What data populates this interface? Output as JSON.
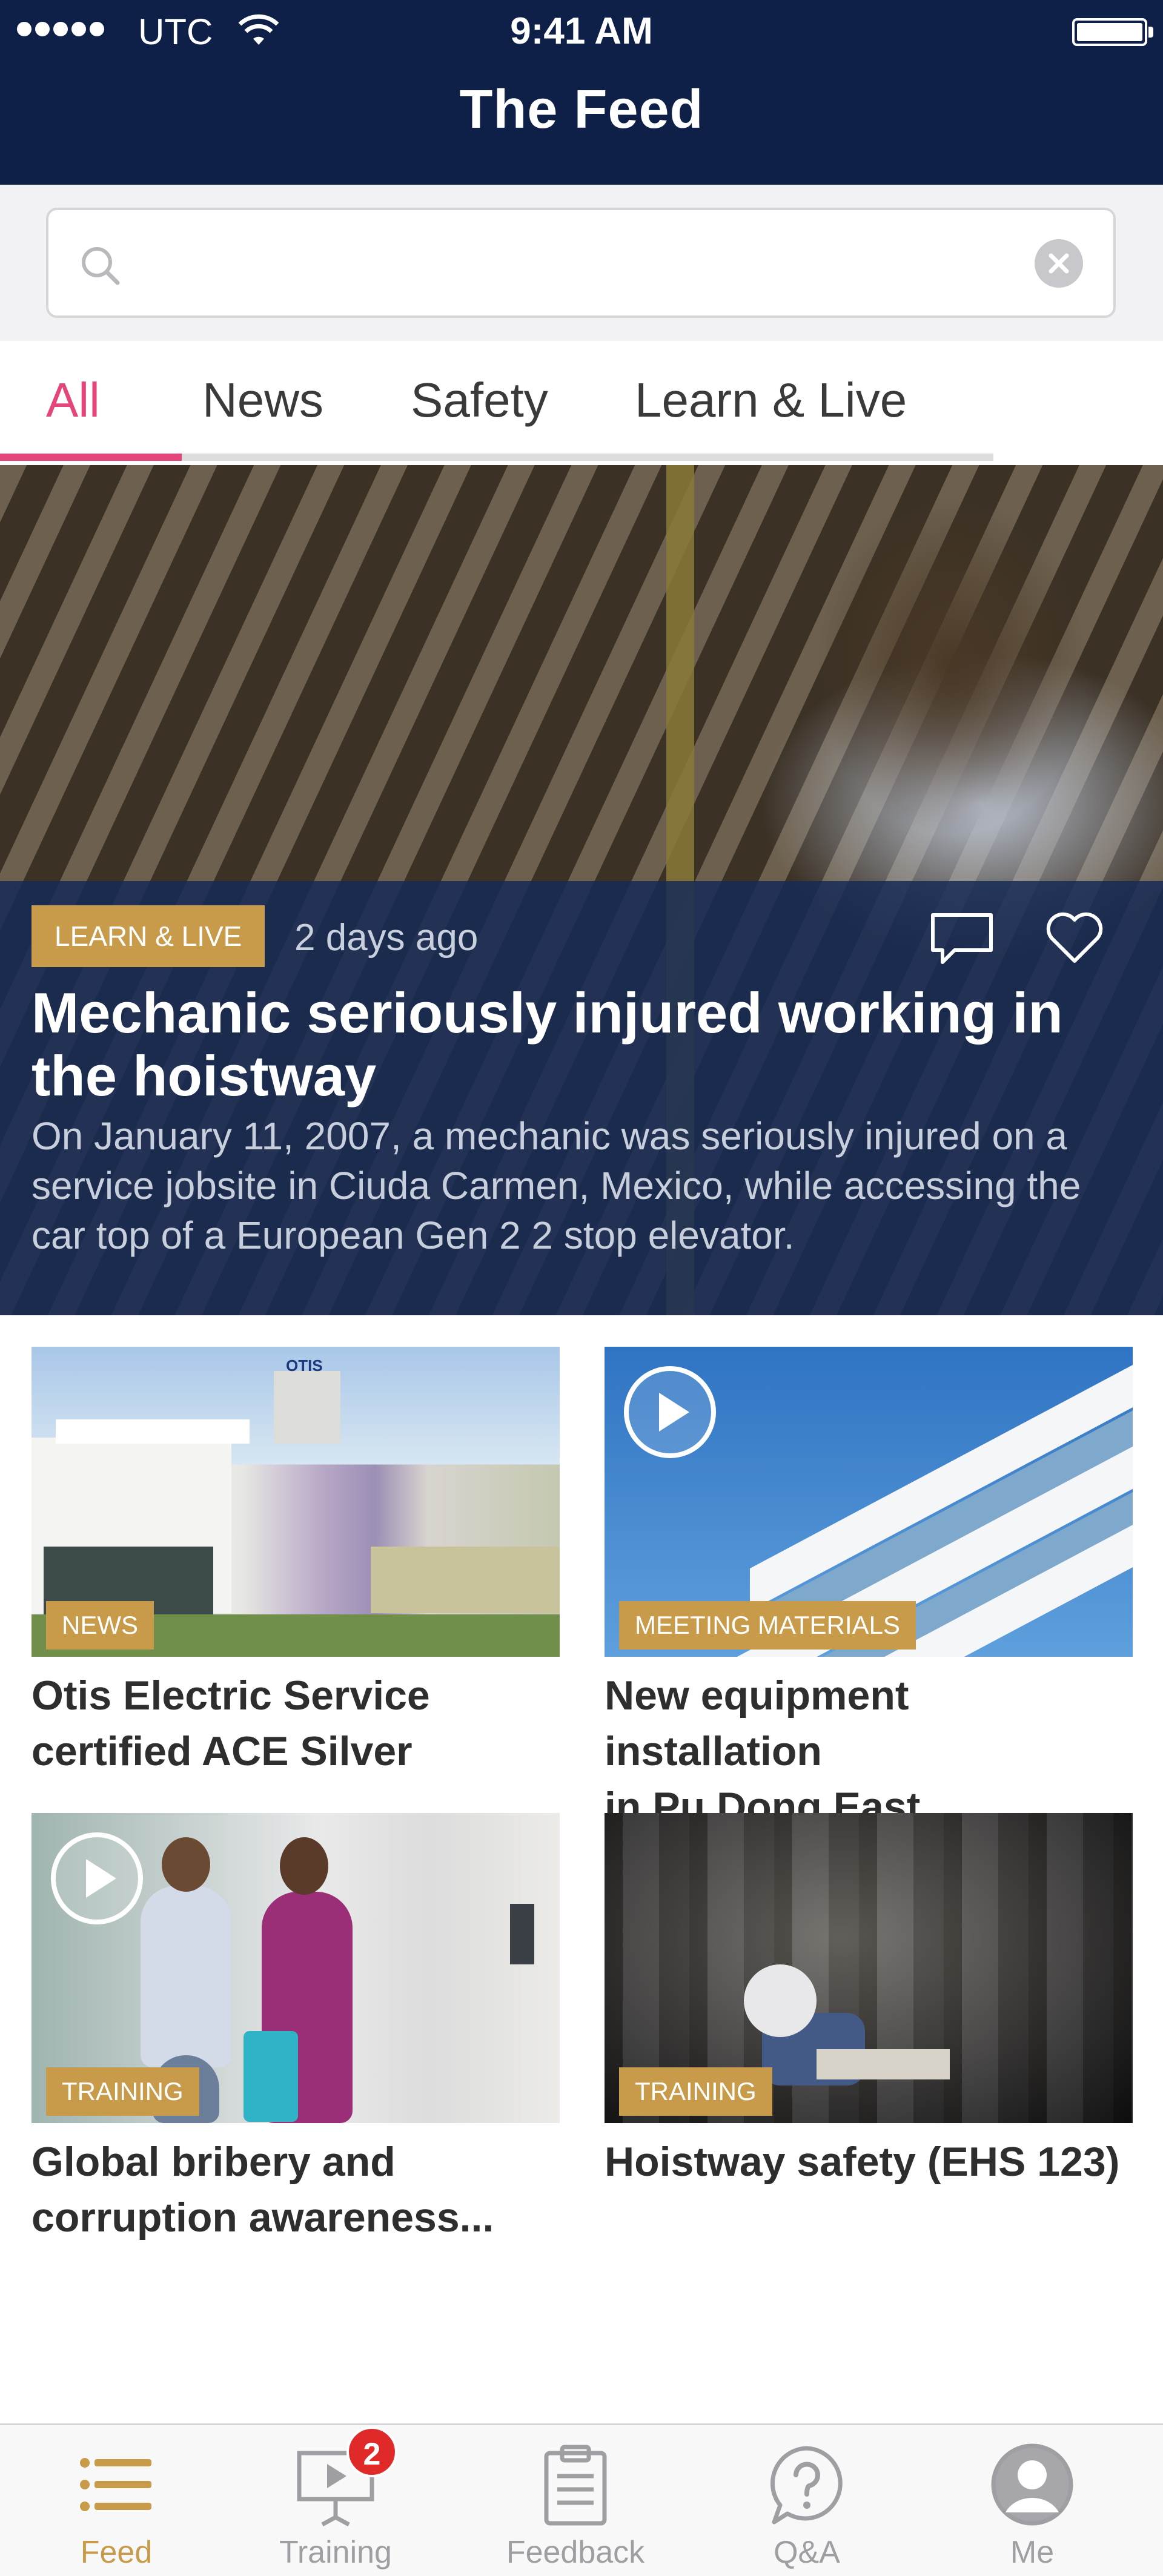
{
  "status_bar": {
    "carrier": "UTC",
    "time": "9:41 AM"
  },
  "nav": {
    "title": "The Feed"
  },
  "search": {
    "value": "",
    "placeholder": ""
  },
  "tabs": [
    {
      "label": "All",
      "active": true
    },
    {
      "label": "News",
      "active": false
    },
    {
      "label": "Safety",
      "active": false
    },
    {
      "label": "Learn & Live",
      "active": false
    }
  ],
  "hero": {
    "badge": "LEARN & LIVE",
    "time_ago": "2 days ago",
    "title": "Mechanic seriously injured working in the hoistway",
    "summary": "On January 11, 2007, a mechanic was seriously injured on a service jobsite in Ciuda Carmen, Mexico, while accessing the car top of a European Gen 2 2 stop elevator."
  },
  "cards": [
    {
      "badge": "NEWS",
      "title_line1": "Otis Electric Service",
      "title_line2": "certified ACE Silver",
      "sign_text": "OTIS",
      "video": false
    },
    {
      "badge": "MEETING MATERIALS",
      "title_line1": "New equipment installation",
      "title_line2": "in Pu Dong East",
      "video": true
    },
    {
      "badge": "TRAINING",
      "title_line1": "Global bribery and",
      "title_line2": "corruption awareness...",
      "video": true
    },
    {
      "badge": "TRAINING",
      "title_line1": "Hoistway safety (EHS 123)",
      "title_line2": "",
      "video": false
    }
  ],
  "tabbar": {
    "items": [
      {
        "label": "Feed",
        "icon": "list-icon",
        "active": true
      },
      {
        "label": "Training",
        "icon": "presentation-icon",
        "active": false,
        "badge": "2"
      },
      {
        "label": "Feedback",
        "icon": "clipboard-icon",
        "active": false
      },
      {
        "label": "Q&A",
        "icon": "question-bubble-icon",
        "active": false
      },
      {
        "label": "Me",
        "icon": "profile-icon",
        "active": false
      }
    ]
  },
  "colors": {
    "navy": "#0e1f48",
    "accent_pink": "#e5467a",
    "gold": "#c79b49",
    "notification_red": "#e02a2a"
  }
}
